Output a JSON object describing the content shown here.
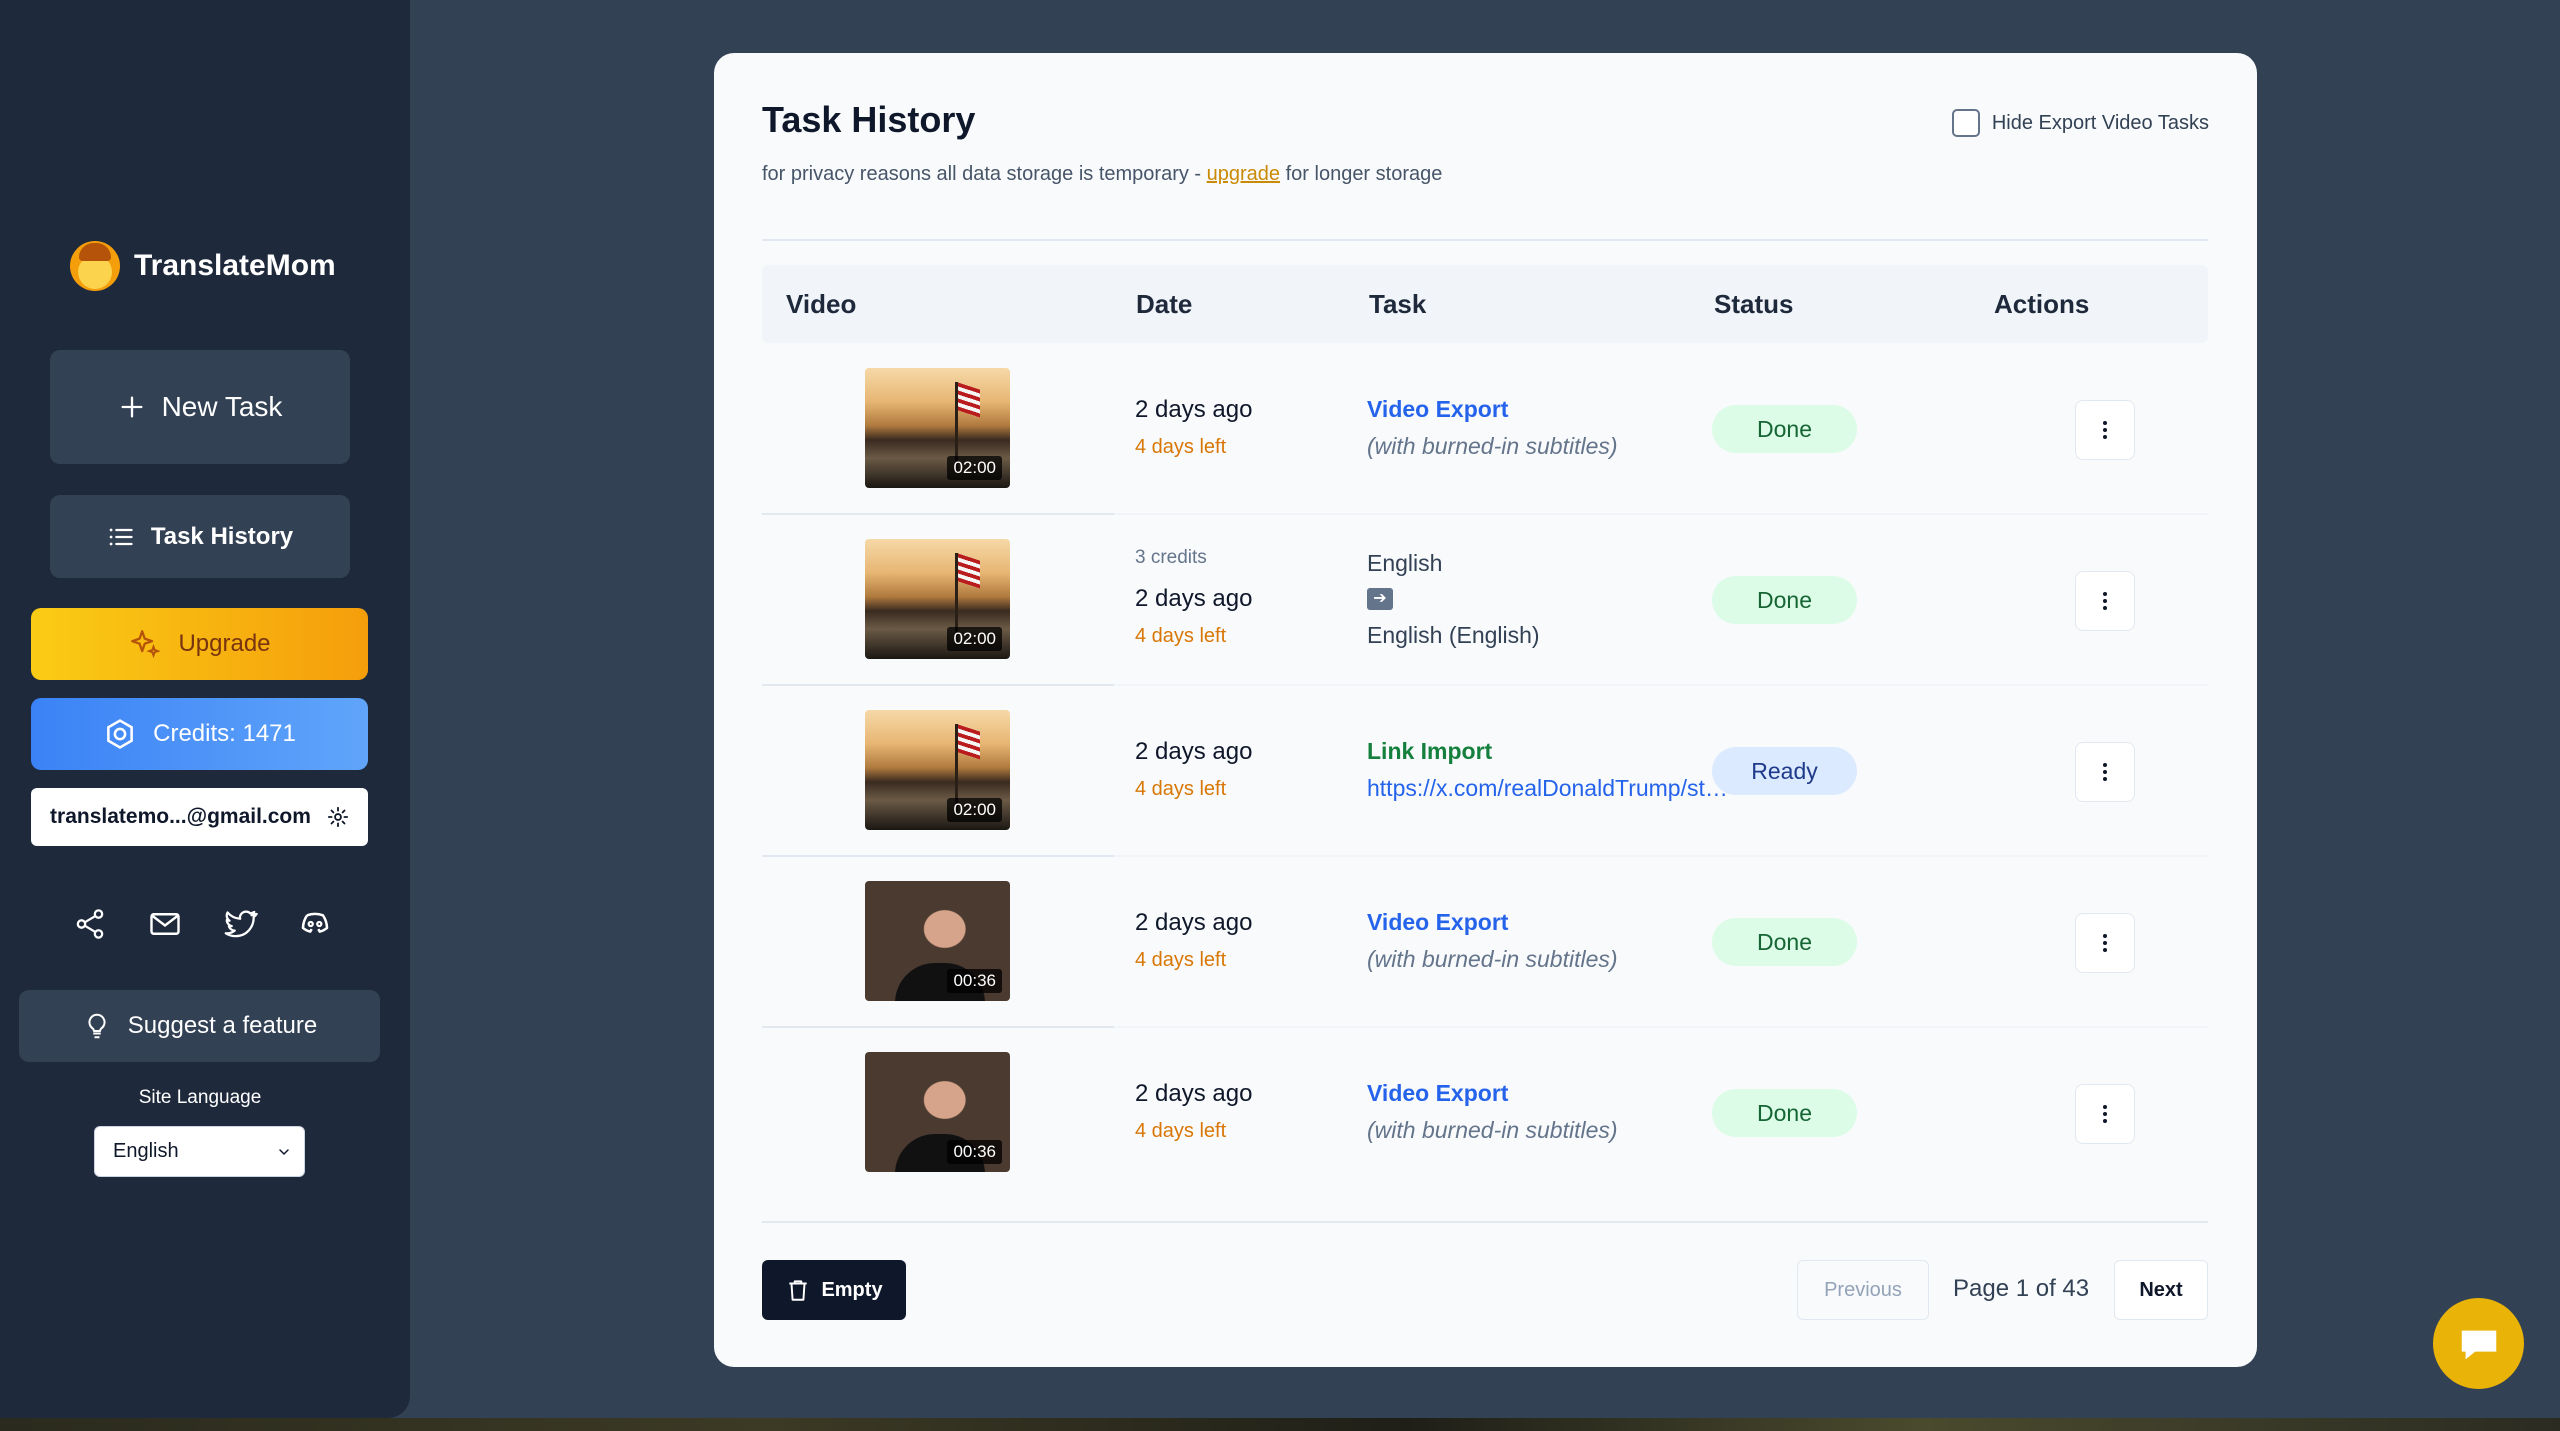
{
  "brand": {
    "name": "TranslateMom"
  },
  "sidebar": {
    "new_task": "New Task",
    "task_history": "Task History",
    "upgrade": "Upgrade",
    "credits": "Credits: 1471",
    "account_email": "translatemo...@gmail.com",
    "suggest": "Suggest a feature",
    "site_language_label": "Site Language",
    "site_language_value": "English",
    "social_icons": [
      "share-icon",
      "mail-icon",
      "twitter-icon",
      "discord-icon"
    ]
  },
  "main": {
    "title": "Task History",
    "subtitle_before": "for privacy reasons all data storage is temporary - ",
    "subtitle_link": "upgrade",
    "subtitle_after": " for longer storage",
    "hide_export_label": "Hide Export Video Tasks",
    "columns": [
      "Video",
      "Date",
      "Task",
      "Status",
      "Actions"
    ]
  },
  "rows": [
    {
      "duration": "02:00",
      "credits": "",
      "date": "2 days ago",
      "days_left": "4 days left",
      "task_title": "Video Export",
      "task_sub": "(with burned-in subtitles)",
      "status": "Done"
    },
    {
      "duration": "02:00",
      "credits": "3 credits",
      "date": "2 days ago",
      "days_left": "4 days left",
      "task_from": "English",
      "task_to": "English (English)",
      "status": "Done"
    },
    {
      "duration": "02:00",
      "credits": "",
      "date": "2 days ago",
      "days_left": "4 days left",
      "task_title": "Link Import",
      "task_url": "https://x.com/realDonaldTrump/status/...",
      "status": "Ready"
    },
    {
      "duration": "00:36",
      "credits": "",
      "date": "2 days ago",
      "days_left": "4 days left",
      "task_title": "Video Export",
      "task_sub": "(with burned-in subtitles)",
      "status": "Done"
    },
    {
      "duration": "00:36",
      "credits": "",
      "date": "2 days ago",
      "days_left": "4 days left",
      "task_title": "Video Export",
      "task_sub": "(with burned-in subtitles)",
      "status": "Done"
    }
  ],
  "footer": {
    "empty": "Empty",
    "previous": "Previous",
    "page_info": "Page 1 of 43",
    "next": "Next"
  },
  "colors": {
    "accent": "#2563eb",
    "upgrade": "#facc15",
    "credits": "#3b82f6",
    "done_bg": "#dcfce7",
    "ready_bg": "#dbeafe",
    "sidebar_bg": "#1e293b"
  }
}
